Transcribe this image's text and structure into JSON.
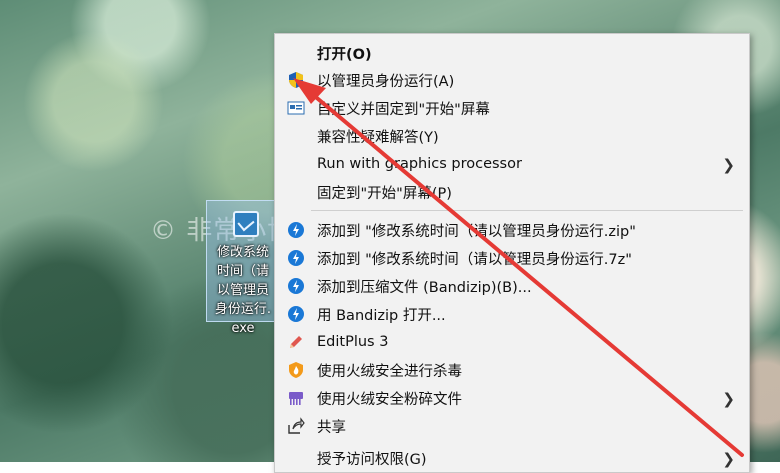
{
  "watermark": "© 非常小博客 beiwangshan.com",
  "desktop_icon": {
    "label": "修改系统时间（请以管理员身份运行.exe"
  },
  "menu": {
    "items": [
      {
        "label": "打开(O)",
        "icon": "none",
        "bold": true,
        "submenu": false
      },
      {
        "label": "以管理员身份运行(A)",
        "icon": "uac-shield-icon",
        "submenu": false
      },
      {
        "label": "自定义并固定到\"开始\"屏幕",
        "icon": "start-pin-icon",
        "submenu": false
      },
      {
        "label": "兼容性疑难解答(Y)",
        "icon": "none",
        "submenu": false
      },
      {
        "label": "Run with graphics processor",
        "icon": "none",
        "submenu": true
      },
      {
        "label": "固定到\"开始\"屏幕(P)",
        "icon": "none",
        "submenu": false
      },
      {
        "label": "添加到 \"修改系统时间（请以管理员身份运行.zip\"",
        "icon": "bandizip-icon",
        "submenu": false
      },
      {
        "label": "添加到 \"修改系统时间（请以管理员身份运行.7z\"",
        "icon": "bandizip-icon",
        "submenu": false
      },
      {
        "label": "添加到压缩文件 (Bandizip)(B)...",
        "icon": "bandizip-icon",
        "submenu": false
      },
      {
        "label": "用 Bandizip 打开...",
        "icon": "bandizip-icon",
        "submenu": false
      },
      {
        "label": "EditPlus 3",
        "icon": "editplus-icon",
        "submenu": false
      },
      {
        "label": "使用火绒安全进行杀毒",
        "icon": "huorong-icon",
        "submenu": false
      },
      {
        "label": "使用火绒安全粉碎文件",
        "icon": "shredder-icon",
        "submenu": true
      },
      {
        "label": "共享",
        "icon": "share-icon",
        "submenu": false
      },
      {
        "label": "授予访问权限(G)",
        "icon": "none",
        "submenu": true
      }
    ]
  },
  "colors": {
    "menu_bg": "#f2f2f2",
    "arrow": "#e53a35"
  }
}
